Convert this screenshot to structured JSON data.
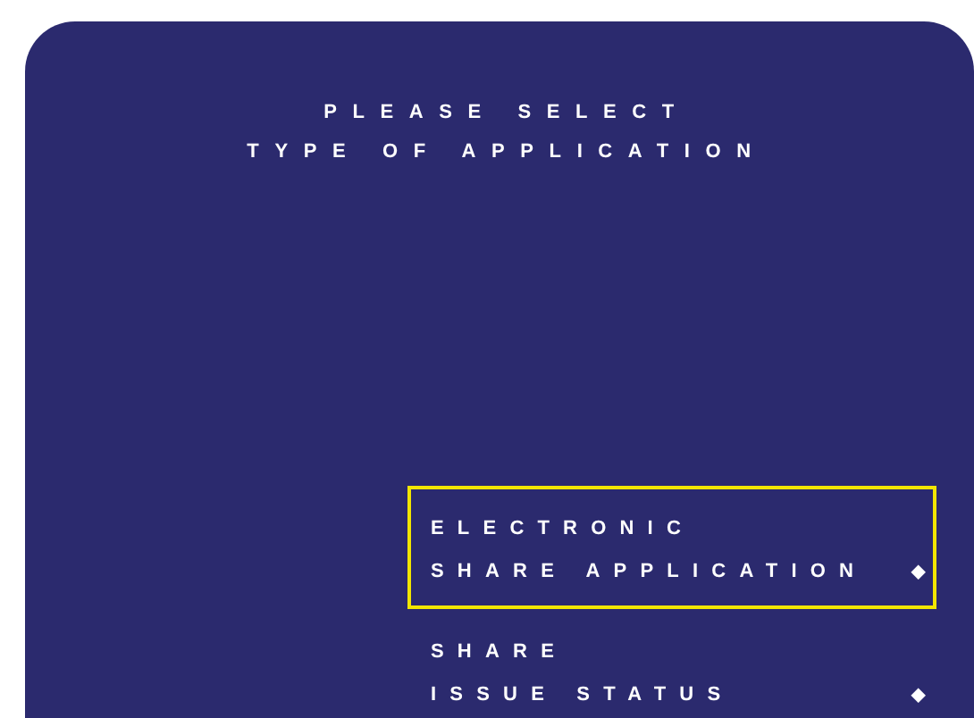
{
  "title_lines": [
    "PLEASE SELECT",
    "TYPE OF APPLICATION"
  ],
  "options": [
    {
      "lines": [
        "ELECTRONIC",
        "SHARE APPLICATION"
      ],
      "marker": "◆",
      "selected": true
    },
    {
      "lines": [
        "SHARE",
        "ISSUE STATUS"
      ],
      "marker": "◆",
      "selected": false
    }
  ]
}
